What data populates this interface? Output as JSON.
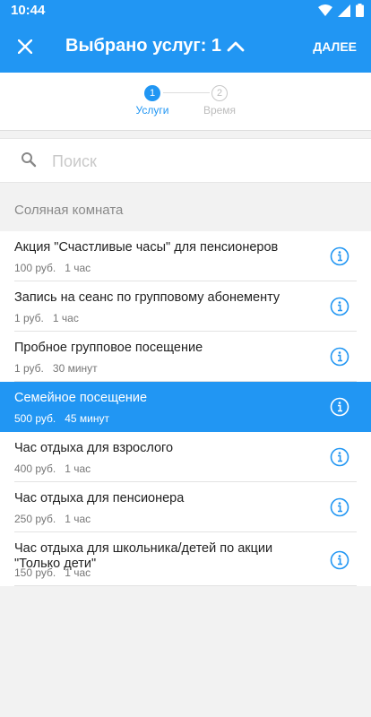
{
  "status_bar": {
    "time": "10:44"
  },
  "header": {
    "title": "Выбрано услуг: 1",
    "next_label": "ДАЛЕЕ"
  },
  "stepper": {
    "steps": [
      {
        "number": "1",
        "label": "Услуги",
        "active": true
      },
      {
        "number": "2",
        "label": "Время",
        "active": false
      }
    ]
  },
  "search": {
    "placeholder": "Поиск",
    "value": ""
  },
  "group": {
    "title": "Соляная комната"
  },
  "services": [
    {
      "title": "Акция \"Счастливые часы\" для пенсионеров",
      "price": "100 руб.",
      "duration": "1 час",
      "selected": false
    },
    {
      "title": "Запись на сеанс по групповому абонементу",
      "price": "1 руб.",
      "duration": "1 час",
      "selected": false
    },
    {
      "title": "Пробное групповое посещение",
      "price": "1 руб.",
      "duration": "30 минут",
      "selected": false
    },
    {
      "title": "Семейное посещение",
      "price": "500 руб.",
      "duration": "45 минут",
      "selected": true
    },
    {
      "title": "Час отдыха для взрослого",
      "price": "400 руб.",
      "duration": "1 час",
      "selected": false
    },
    {
      "title": "Час отдыха для пенсионера",
      "price": "250 руб.",
      "duration": "1 час",
      "selected": false
    },
    {
      "title": "Час отдыха для школьника/детей по акции \"Только дети\"",
      "price": "150 руб.",
      "duration": "1 час",
      "selected": false
    }
  ],
  "colors": {
    "primary": "#2196f3",
    "background": "#f2f2f2",
    "selected_row": "#2196f3"
  },
  "icons": {
    "close": "close-icon",
    "chevron": "chevron-up-icon",
    "search": "search-icon",
    "info": "info-icon"
  }
}
